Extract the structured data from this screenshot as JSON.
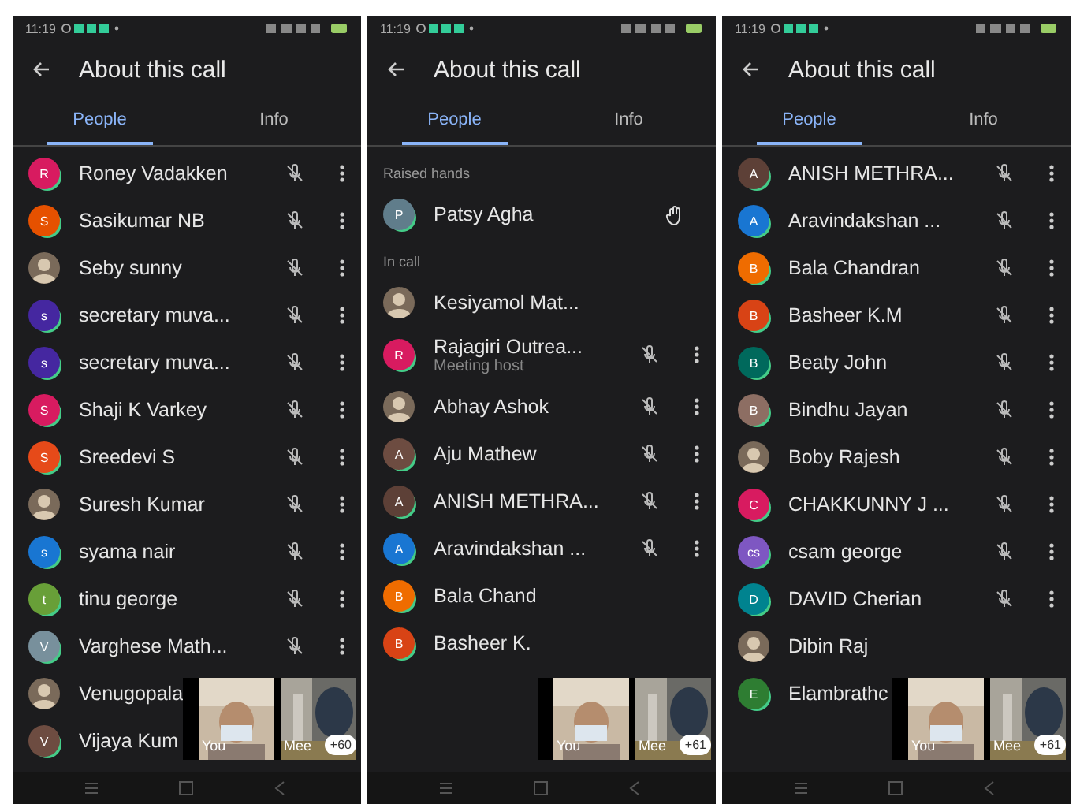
{
  "panels": [
    {
      "status": {
        "time": "11:19"
      },
      "title": "About this call",
      "tabs": [
        {
          "label": "People",
          "selected": true
        },
        {
          "label": "Info",
          "selected": false
        }
      ],
      "sections": [
        {
          "kind": "in_call",
          "people": [
            {
              "name": "Roney Vadakken",
              "avatar": {
                "kind": "initial",
                "initial": "R",
                "color": "#d81b60"
              },
              "muted": true,
              "more": true
            },
            {
              "name": "Sasikumar NB",
              "avatar": {
                "kind": "initial",
                "initial": "S",
                "color": "#e65100"
              },
              "muted": true,
              "more": true
            },
            {
              "name": "Seby sunny",
              "muted": true,
              "more": true
            },
            {
              "name": "secretary muva...",
              "avatar": {
                "kind": "initial",
                "initial": "s",
                "color": "#4527a0"
              },
              "muted": true,
              "more": true
            },
            {
              "name": "secretary muva...",
              "avatar": {
                "kind": "initial",
                "initial": "s",
                "color": "#4527a0"
              },
              "muted": true,
              "more": true
            },
            {
              "name": "Shaji K Varkey",
              "avatar": {
                "kind": "initial",
                "initial": "S",
                "color": "#d81b60"
              },
              "muted": true,
              "more": true
            },
            {
              "name": "Sreedevi S",
              "avatar": {
                "kind": "initial",
                "initial": "S",
                "color": "#e64a19"
              },
              "muted": true,
              "more": true
            },
            {
              "name": "Suresh Kumar",
              "muted": true,
              "more": true
            },
            {
              "name": "syama nair",
              "avatar": {
                "kind": "initial",
                "initial": "s",
                "color": "#1976d2"
              },
              "muted": true,
              "more": true
            },
            {
              "name": "tinu george",
              "avatar": {
                "kind": "initial",
                "initial": "t",
                "color": "#689f38"
              },
              "muted": true,
              "more": true
            },
            {
              "name": "Varghese Math...",
              "avatar": {
                "kind": "initial",
                "initial": "V",
                "color": "#78909c"
              },
              "muted": true,
              "more": true
            },
            {
              "name": "Venugopala",
              "muted": false,
              "more": false
            },
            {
              "name": "Vijaya Kum",
              "avatar": {
                "kind": "initial",
                "initial": "V",
                "color": "#6d4c41"
              },
              "muted": false,
              "more": false
            }
          ]
        }
      ],
      "tiles": [
        {
          "label": "You"
        },
        {
          "label": "Mee",
          "count": "+60"
        }
      ]
    },
    {
      "status": {
        "time": "11:19"
      },
      "title": "About this call",
      "tabs": [
        {
          "label": "People",
          "selected": true
        },
        {
          "label": "Info",
          "selected": false
        }
      ],
      "sections": [
        {
          "kind": "raised_hands",
          "heading": "Raised hands",
          "people": [
            {
              "name": "Patsy Agha",
              "avatar": {
                "kind": "initial",
                "initial": "P",
                "color": "#607d8b"
              },
              "muted": false,
              "more": false
            }
          ]
        },
        {
          "kind": "in_call",
          "heading": "In call",
          "people": [
            {
              "name": "Kesiyamol Mat...",
              "muted": false,
              "more": false
            },
            {
              "name": "Rajagiri Outrea...",
              "subtitle": "Meeting host",
              "avatar": {
                "kind": "initial",
                "initial": "R",
                "color": "#d81b60"
              },
              "muted": true,
              "more": true
            },
            {
              "name": "Abhay Ashok",
              "muted": true,
              "more": true
            },
            {
              "name": "Aju Mathew",
              "avatar": {
                "kind": "initial",
                "initial": "A",
                "color": "#6d4c41"
              },
              "muted": true,
              "more": true
            },
            {
              "name": "ANISH METHRA...",
              "avatar": {
                "kind": "initial",
                "initial": "A",
                "color": "#5d4037"
              },
              "muted": true,
              "more": true
            },
            {
              "name": "Aravindakshan ...",
              "avatar": {
                "kind": "initial",
                "initial": "A",
                "color": "#1976d2"
              },
              "muted": true,
              "more": true
            },
            {
              "name": "Bala Chand",
              "avatar": {
                "kind": "initial",
                "initial": "B",
                "color": "#ef6c00"
              },
              "muted": false,
              "more": false
            },
            {
              "name": "Basheer K.",
              "avatar": {
                "kind": "initial",
                "initial": "B",
                "color": "#d84315"
              },
              "muted": false,
              "more": false
            }
          ]
        }
      ],
      "tiles": [
        {
          "label": "You"
        },
        {
          "label": "Mee",
          "count": "+61"
        }
      ]
    },
    {
      "status": {
        "time": "11:19"
      },
      "title": "About this call",
      "tabs": [
        {
          "label": "People",
          "selected": true
        },
        {
          "label": "Info",
          "selected": false
        }
      ],
      "sections": [
        {
          "kind": "in_call",
          "people": [
            {
              "name": "ANISH METHRA...",
              "avatar": {
                "kind": "initial",
                "initial": "A",
                "color": "#5d4037"
              },
              "muted": true,
              "more": true
            },
            {
              "name": "Aravindakshan ...",
              "avatar": {
                "kind": "initial",
                "initial": "A",
                "color": "#1976d2"
              },
              "muted": true,
              "more": true
            },
            {
              "name": "Bala Chandran",
              "avatar": {
                "kind": "initial",
                "initial": "B",
                "color": "#ef6c00"
              },
              "muted": true,
              "more": true
            },
            {
              "name": "Basheer K.M",
              "avatar": {
                "kind": "initial",
                "initial": "B",
                "color": "#d84315"
              },
              "muted": true,
              "more": true
            },
            {
              "name": "Beaty John",
              "avatar": {
                "kind": "initial",
                "initial": "B",
                "color": "#00695c"
              },
              "muted": true,
              "more": true
            },
            {
              "name": "Bindhu Jayan",
              "avatar": {
                "kind": "initial",
                "initial": "B",
                "color": "#8d6e63"
              },
              "muted": true,
              "more": true
            },
            {
              "name": "Boby Rajesh",
              "muted": true,
              "more": true
            },
            {
              "name": "CHAKKUNNY J ...",
              "avatar": {
                "kind": "initial",
                "initial": "C",
                "color": "#d81b60"
              },
              "muted": true,
              "more": true
            },
            {
              "name": "csam george",
              "avatar": {
                "kind": "initial",
                "initial": "cs",
                "color": "#7e57c2"
              },
              "muted": true,
              "more": true
            },
            {
              "name": "DAVID Cherian",
              "avatar": {
                "kind": "initial",
                "initial": "D",
                "color": "#00838f"
              },
              "muted": true,
              "more": true
            },
            {
              "name": "Dibin Raj",
              "muted": false,
              "more": false
            },
            {
              "name": "Elambrathc",
              "avatar": {
                "kind": "initial",
                "initial": "E",
                "color": "#2e7d32"
              },
              "muted": false,
              "more": false
            }
          ]
        }
      ],
      "tiles": [
        {
          "label": "You"
        },
        {
          "label": "Mee",
          "count": "+61"
        }
      ]
    }
  ]
}
